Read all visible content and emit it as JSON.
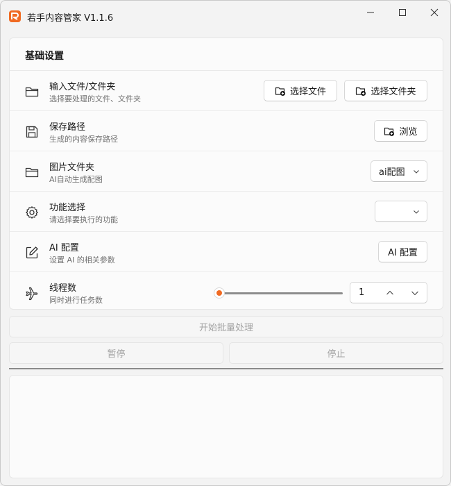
{
  "window": {
    "title": "若手内容管家 V1.1.6",
    "accent_color": "#f06a22"
  },
  "settings": {
    "header": "基础设置",
    "rows": [
      {
        "icon": "folder-icon",
        "title": "输入文件/文件夹",
        "subtitle": "选择要处理的文件、文件夹",
        "buttons": [
          "选择文件",
          "选择文件夹"
        ]
      },
      {
        "icon": "save-icon",
        "title": "保存路径",
        "subtitle": "生成的内容保存路径",
        "buttons": [
          "浏览"
        ]
      },
      {
        "icon": "folder-icon",
        "title": "图片文件夹",
        "subtitle": "AI自动生成配图",
        "select": {
          "value": "ai配图"
        }
      },
      {
        "icon": "gear-icon",
        "title": "功能选择",
        "subtitle": "请选择要执行的功能",
        "select": {
          "value": ""
        }
      },
      {
        "icon": "edit-icon",
        "title": "AI 配置",
        "subtitle": "设置 AI 的相关参数",
        "buttons": [
          "AI 配置"
        ]
      },
      {
        "icon": "airplane-icon",
        "title": "线程数",
        "subtitle": "同时进行任务数",
        "slider": {
          "value": 1,
          "min": 1,
          "max": 10
        },
        "number": {
          "value": "1"
        }
      }
    ]
  },
  "actions": {
    "start": "开始批量处理",
    "pause": "暂停",
    "stop": "停止"
  },
  "progress": {
    "value": 0
  }
}
